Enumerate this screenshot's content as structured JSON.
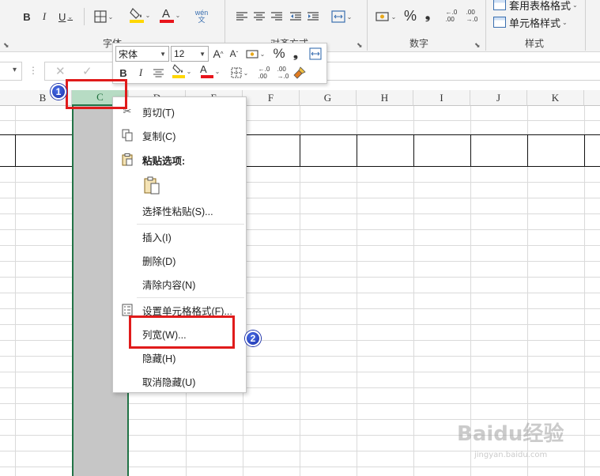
{
  "ribbon": {
    "font_group": {
      "label": "字体",
      "bold": "B",
      "italic": "I",
      "underline": "U",
      "phonetic": "wén\n文"
    },
    "alignment_group": {
      "label": "对齐方式"
    },
    "number_group": {
      "label": "数字",
      "percent": "%",
      "comma": "❟",
      "inc_decimal": "←.0\n.00",
      "dec_decimal": ".00\n→.0"
    },
    "styles_group": {
      "label": "样式",
      "table_format": "套用表格格式",
      "cell_styles": "单元格样式"
    }
  },
  "columns": [
    "B",
    "C",
    "D",
    "E",
    "F",
    "G",
    "H",
    "I",
    "J",
    "K"
  ],
  "selected_column": "C",
  "mini_toolbar": {
    "font": "宋体",
    "size": "12",
    "grow": "A",
    "shrink": "A",
    "percent": "%",
    "comma": "❟",
    "bold": "B",
    "italic": "I",
    "font_color_letter": "A",
    "inc_decimal": "←.0\n.00",
    "dec_decimal": ".00\n→.0"
  },
  "context_menu": {
    "cut": "剪切(T)",
    "copy": "复制(C)",
    "paste_options": "粘贴选项:",
    "paste_special": "选择性粘贴(S)...",
    "insert": "插入(I)",
    "delete": "删除(D)",
    "clear": "清除内容(N)",
    "format_cells": "设置单元格格式(F)...",
    "column_width": "列宽(W)...",
    "hide": "隐藏(H)",
    "unhide": "取消隐藏(U)"
  },
  "annotations": {
    "step1": "1",
    "step2": "2",
    "highlight_color": "#e01b1b"
  },
  "colors": {
    "accent": "#217346",
    "selected_header": "#b7dcc4",
    "selected_column": "#c6c6c6"
  },
  "watermark": {
    "main": "Baidu经验",
    "sub": "jingyan.baidu.com"
  }
}
